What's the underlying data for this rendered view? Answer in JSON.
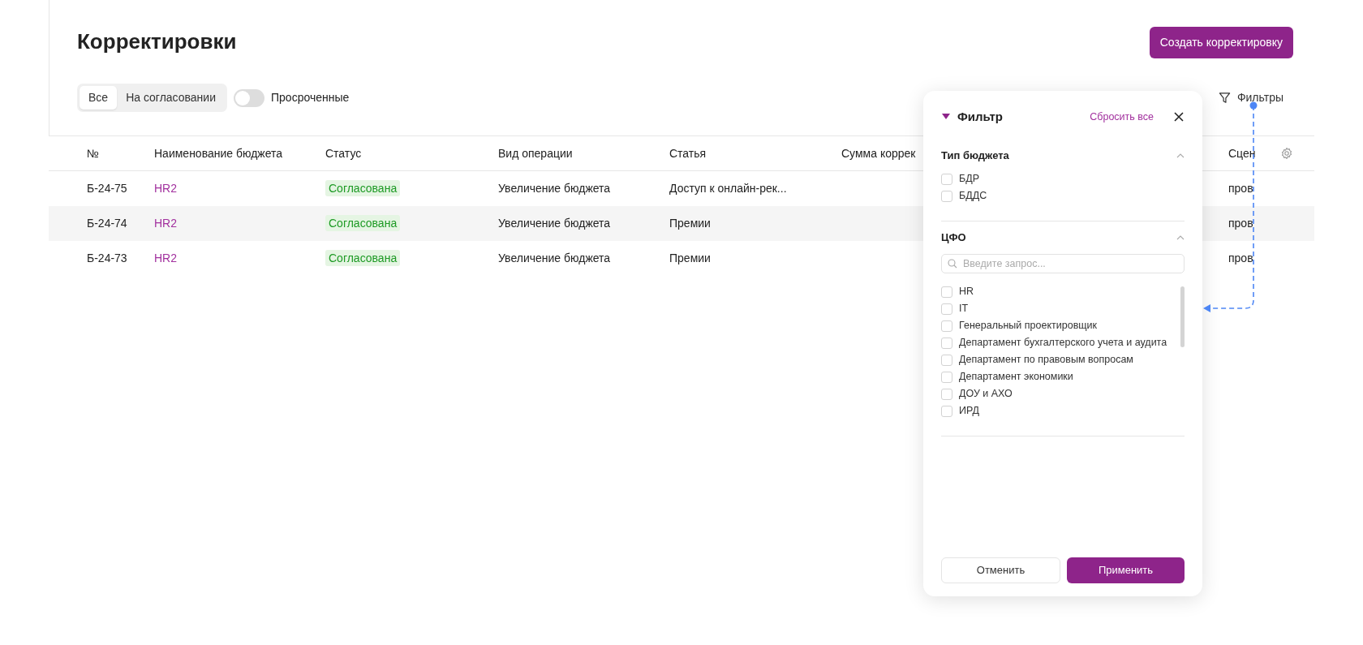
{
  "page_title": "Корректировки",
  "create_button": "Создать корректировку",
  "segments": [
    {
      "label": "Все",
      "selected": true
    },
    {
      "label": "На согласовании",
      "selected": false
    }
  ],
  "overdue_toggle": {
    "label": "Просроченные",
    "on": false
  },
  "filters_link": "Фильтры",
  "table": {
    "columns": [
      "№",
      "Наименование бюджета",
      "Статус",
      "Вид операции",
      "Статья",
      "Сумма коррек",
      "Сцен"
    ],
    "rows": [
      {
        "number": "Б-24-75",
        "budget": "HR2",
        "status": "Согласована",
        "operation": "Увеличение бюджета",
        "article": "Доступ к онлайн-рек...",
        "column_6": "пров",
        "hovered": false
      },
      {
        "number": "Б-24-74",
        "budget": "HR2",
        "status": "Согласована",
        "operation": "Увеличение бюджета",
        "article": "Премии",
        "column_6": "пров",
        "hovered": true
      },
      {
        "number": "Б-24-73",
        "budget": "HR2",
        "status": "Согласована",
        "operation": "Увеличение бюджета",
        "article": "Премии",
        "column_6": "пров",
        "hovered": false
      }
    ]
  },
  "filter_panel": {
    "title": "Фильтр",
    "reset": "Сбросить все",
    "sections": [
      {
        "title": "Тип бюджета",
        "expanded": true,
        "options": [
          {
            "label": "БДР",
            "checked": false
          },
          {
            "label": "БДДС",
            "checked": false
          }
        ]
      },
      {
        "title": "ЦФО",
        "expanded": true,
        "search": {
          "placeholder": "Введите запрос..."
        },
        "options": [
          {
            "label": "HR",
            "checked": false
          },
          {
            "label": "IT",
            "checked": false
          },
          {
            "label": "Генеральный проектировщик",
            "checked": false
          },
          {
            "label": "Департамент бухгалтерского учета и аудита",
            "checked": false
          },
          {
            "label": "Департамент по правовым вопросам",
            "checked": false
          },
          {
            "label": "Департамент экономики",
            "checked": false
          },
          {
            "label": "ДОУ и АХО",
            "checked": false
          },
          {
            "label": "ИРД",
            "checked": false
          }
        ]
      }
    ],
    "buttons": {
      "cancel": "Отменить",
      "apply": "Применить"
    }
  }
}
